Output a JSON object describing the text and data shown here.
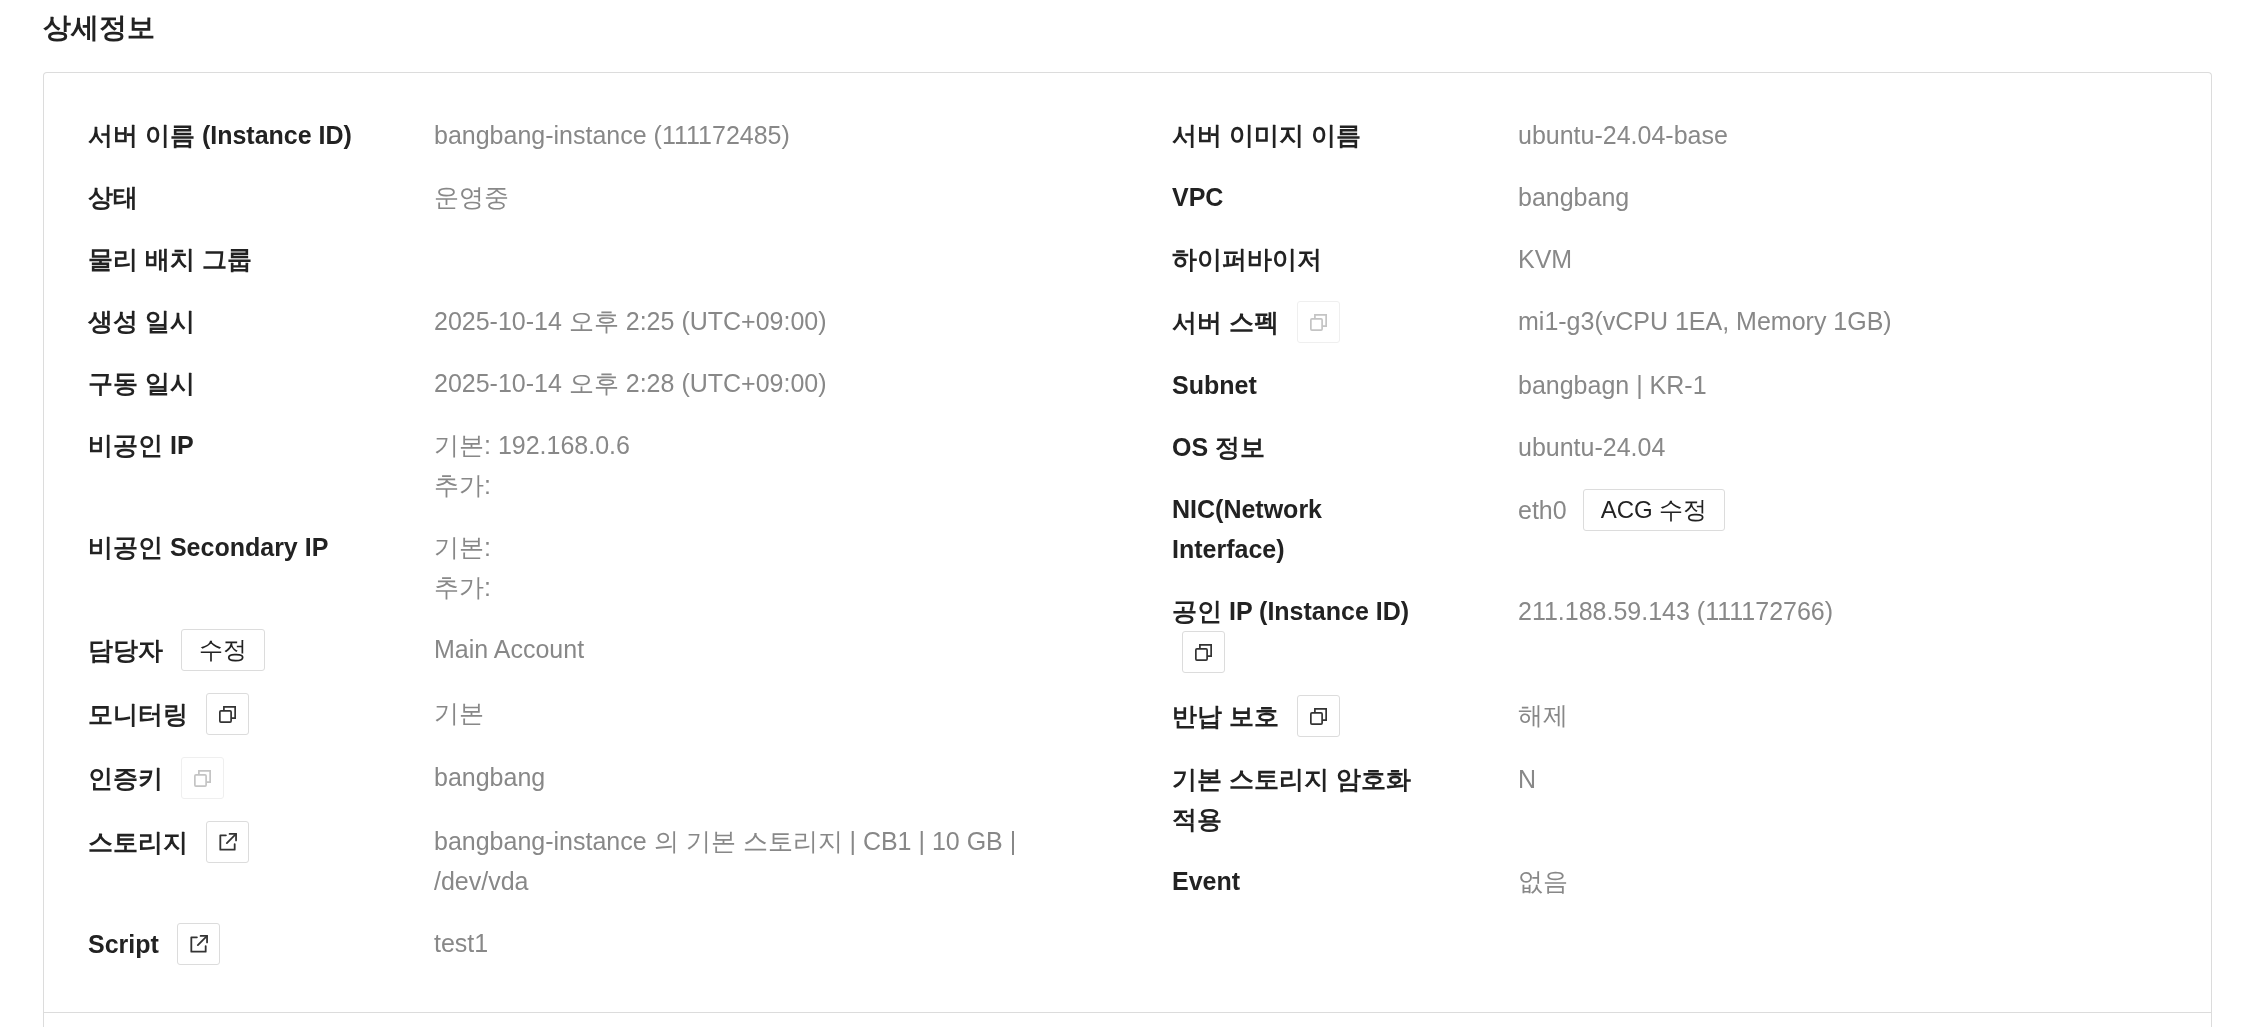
{
  "section": {
    "title": "상세정보"
  },
  "left_fields": [
    {
      "label": "서버 이름 (Instance ID)",
      "values": [
        "bangbang-instance (111172485)"
      ]
    },
    {
      "label": "상태",
      "values": [
        "운영중"
      ]
    },
    {
      "label": "물리 배치 그룹"
    },
    {
      "label": "생성 일시",
      "values": [
        "2025-10-14 오후 2:25 (UTC+09:00)"
      ]
    },
    {
      "label": "구동 일시",
      "values": [
        "2025-10-14 오후 2:28 (UTC+09:00)"
      ]
    },
    {
      "label": "비공인 IP",
      "values": [
        "기본: 192.168.0.6",
        "추가:"
      ]
    },
    {
      "label": "비공인 Secondary IP",
      "values": [
        "기본:",
        "추가:"
      ]
    },
    {
      "label": "담당자",
      "action": {
        "kind": "text",
        "label": "수정",
        "disabled": false
      },
      "values": [
        "Main Account"
      ]
    },
    {
      "label": "모니터링",
      "action": {
        "kind": "copy",
        "disabled": false
      },
      "values": [
        "기본"
      ]
    },
    {
      "label": "인증키",
      "action": {
        "kind": "copy",
        "disabled": true
      },
      "values": [
        "bangbang"
      ]
    },
    {
      "label": "스토리지",
      "action": {
        "kind": "external-link",
        "disabled": false
      },
      "values": [
        "bangbang-instance 의 기본 스토리지 | CB1 | 10 GB | /dev/vda"
      ]
    },
    {
      "label": "Script",
      "action": {
        "kind": "external-link",
        "disabled": false
      },
      "values": [
        "test1"
      ]
    }
  ],
  "right_fields": [
    {
      "label": "서버 이미지 이름",
      "values": [
        "ubuntu-24.04-base"
      ]
    },
    {
      "label": "VPC",
      "values": [
        "bangbang"
      ]
    },
    {
      "label": "하이퍼바이저",
      "values": [
        "KVM"
      ]
    },
    {
      "label": "서버 스펙",
      "action": {
        "kind": "copy",
        "disabled": true
      },
      "values": [
        "mi1-g3(vCPU 1EA, Memory 1GB)"
      ]
    },
    {
      "label": "Subnet",
      "values": [
        "bangbagn | KR-1"
      ]
    },
    {
      "label": "OS 정보",
      "values": [
        "ubuntu-24.04"
      ]
    },
    {
      "label": "NIC(Network Interface)",
      "values": [
        "eth0"
      ],
      "value_action": {
        "kind": "text",
        "label": "ACG 수정",
        "disabled": false
      }
    },
    {
      "label": "공인 IP (Instance ID)",
      "action": {
        "kind": "copy",
        "disabled": false
      },
      "values": [
        "211.188.59.143 (111172766)"
      ]
    },
    {
      "label": "반납 보호",
      "action": {
        "kind": "copy",
        "disabled": false
      },
      "values": [
        "해제"
      ]
    },
    {
      "label": "기본 스토리지 암호화 적용",
      "values": [
        "N"
      ]
    },
    {
      "label": "Event",
      "values": [
        "없음"
      ]
    }
  ]
}
